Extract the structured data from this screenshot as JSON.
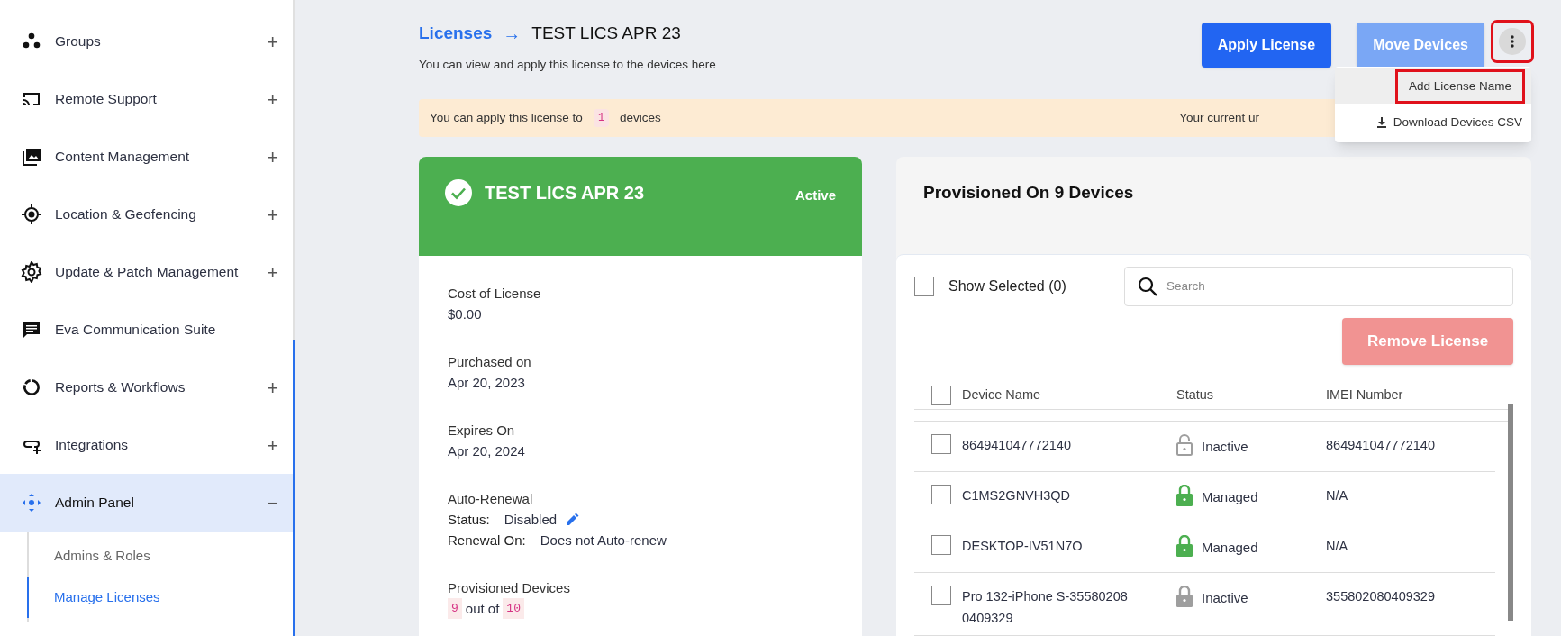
{
  "sidebar": {
    "items": [
      {
        "label": "Groups",
        "toggle": "+",
        "selected": false
      },
      {
        "label": "Remote Support",
        "toggle": "+",
        "selected": false
      },
      {
        "label": "Content Management",
        "toggle": "+",
        "selected": false
      },
      {
        "label": "Location & Geofencing",
        "toggle": "+",
        "selected": false
      },
      {
        "label": "Update & Patch Management",
        "toggle": "+",
        "selected": false
      },
      {
        "label": "Eva Communication Suite",
        "selected": false
      },
      {
        "label": "Reports & Workflows",
        "toggle": "+",
        "selected": false
      },
      {
        "label": "Integrations",
        "toggle": "+",
        "selected": false
      },
      {
        "label": "Admin Panel",
        "toggle": "−",
        "selected": true,
        "expanded": true,
        "children": [
          {
            "label": "Admins & Roles",
            "selected": false
          },
          {
            "label": "Manage Licenses",
            "selected": true
          }
        ]
      }
    ]
  },
  "header": {
    "breadcrumb": "Licenses",
    "arrow": "→",
    "title": "TEST LICS APR 23",
    "subtitle": "You can view and apply this license to the devices here",
    "buttons": [
      {
        "label": "Apply License",
        "disabled": false
      },
      {
        "label": "Move Devices",
        "disabled": true
      }
    ],
    "more_button": {
      "highlighted": true
    },
    "menu": [
      {
        "label": "Add License Name",
        "kind": "plain",
        "highlighted": true
      },
      {
        "label": "Download Devices CSV",
        "kind": "download",
        "highlighted": false
      }
    ]
  },
  "alert": {
    "text_before": "You can apply this license to",
    "count": "1",
    "text_after": "devices",
    "right_text": "Your current ur"
  },
  "license_card": {
    "name": "TEST LICS APR 23",
    "status": "Active",
    "fields": [
      {
        "label": "Cost of License",
        "value": "$0.00"
      },
      {
        "label": "Purchased on",
        "value": "Apr 20, 2023"
      },
      {
        "label": "Expires On",
        "value": "Apr 20, 2024"
      }
    ],
    "auto_renewal": {
      "label": "Auto-Renewal",
      "status_label": "Status:",
      "status_value": "Disabled",
      "renewal_label": "Renewal On:",
      "renewal_value": "Does not Auto-renew"
    },
    "provisioned": {
      "label": "Provisioned Devices",
      "used": "9",
      "middle": "out of",
      "total": "10"
    }
  },
  "devices_panel": {
    "title": "Provisioned On 9 Devices",
    "show_selected": {
      "label": "Show Selected (0)",
      "checked": false
    },
    "search": {
      "placeholder": "Search"
    },
    "remove_button": {
      "label": "Remove License",
      "disabled": true
    },
    "table": {
      "select_all": false,
      "columns": [
        "Device Name",
        "Status",
        "IMEI Number"
      ],
      "rows": [
        {
          "name": "864941047772140",
          "status": "Inactive",
          "kind": "unlocked",
          "color": "#9e9e9e",
          "imei": "864941047772140",
          "checked": false
        },
        {
          "name": "C1MS2GNVH3QD",
          "status": "Managed",
          "kind": "locked",
          "color": "#4caf50",
          "imei": "N/A",
          "checked": false
        },
        {
          "name": "DESKTOP-IV51N7O",
          "status": "Managed",
          "kind": "locked",
          "color": "#4caf50",
          "imei": "N/A",
          "checked": false
        },
        {
          "name": "Pro 132-iPhone S-355802080409329",
          "status": "Inactive",
          "kind": "locked",
          "color": "#9e9e9e",
          "imei": "355802080409329",
          "checked": false
        }
      ]
    }
  }
}
